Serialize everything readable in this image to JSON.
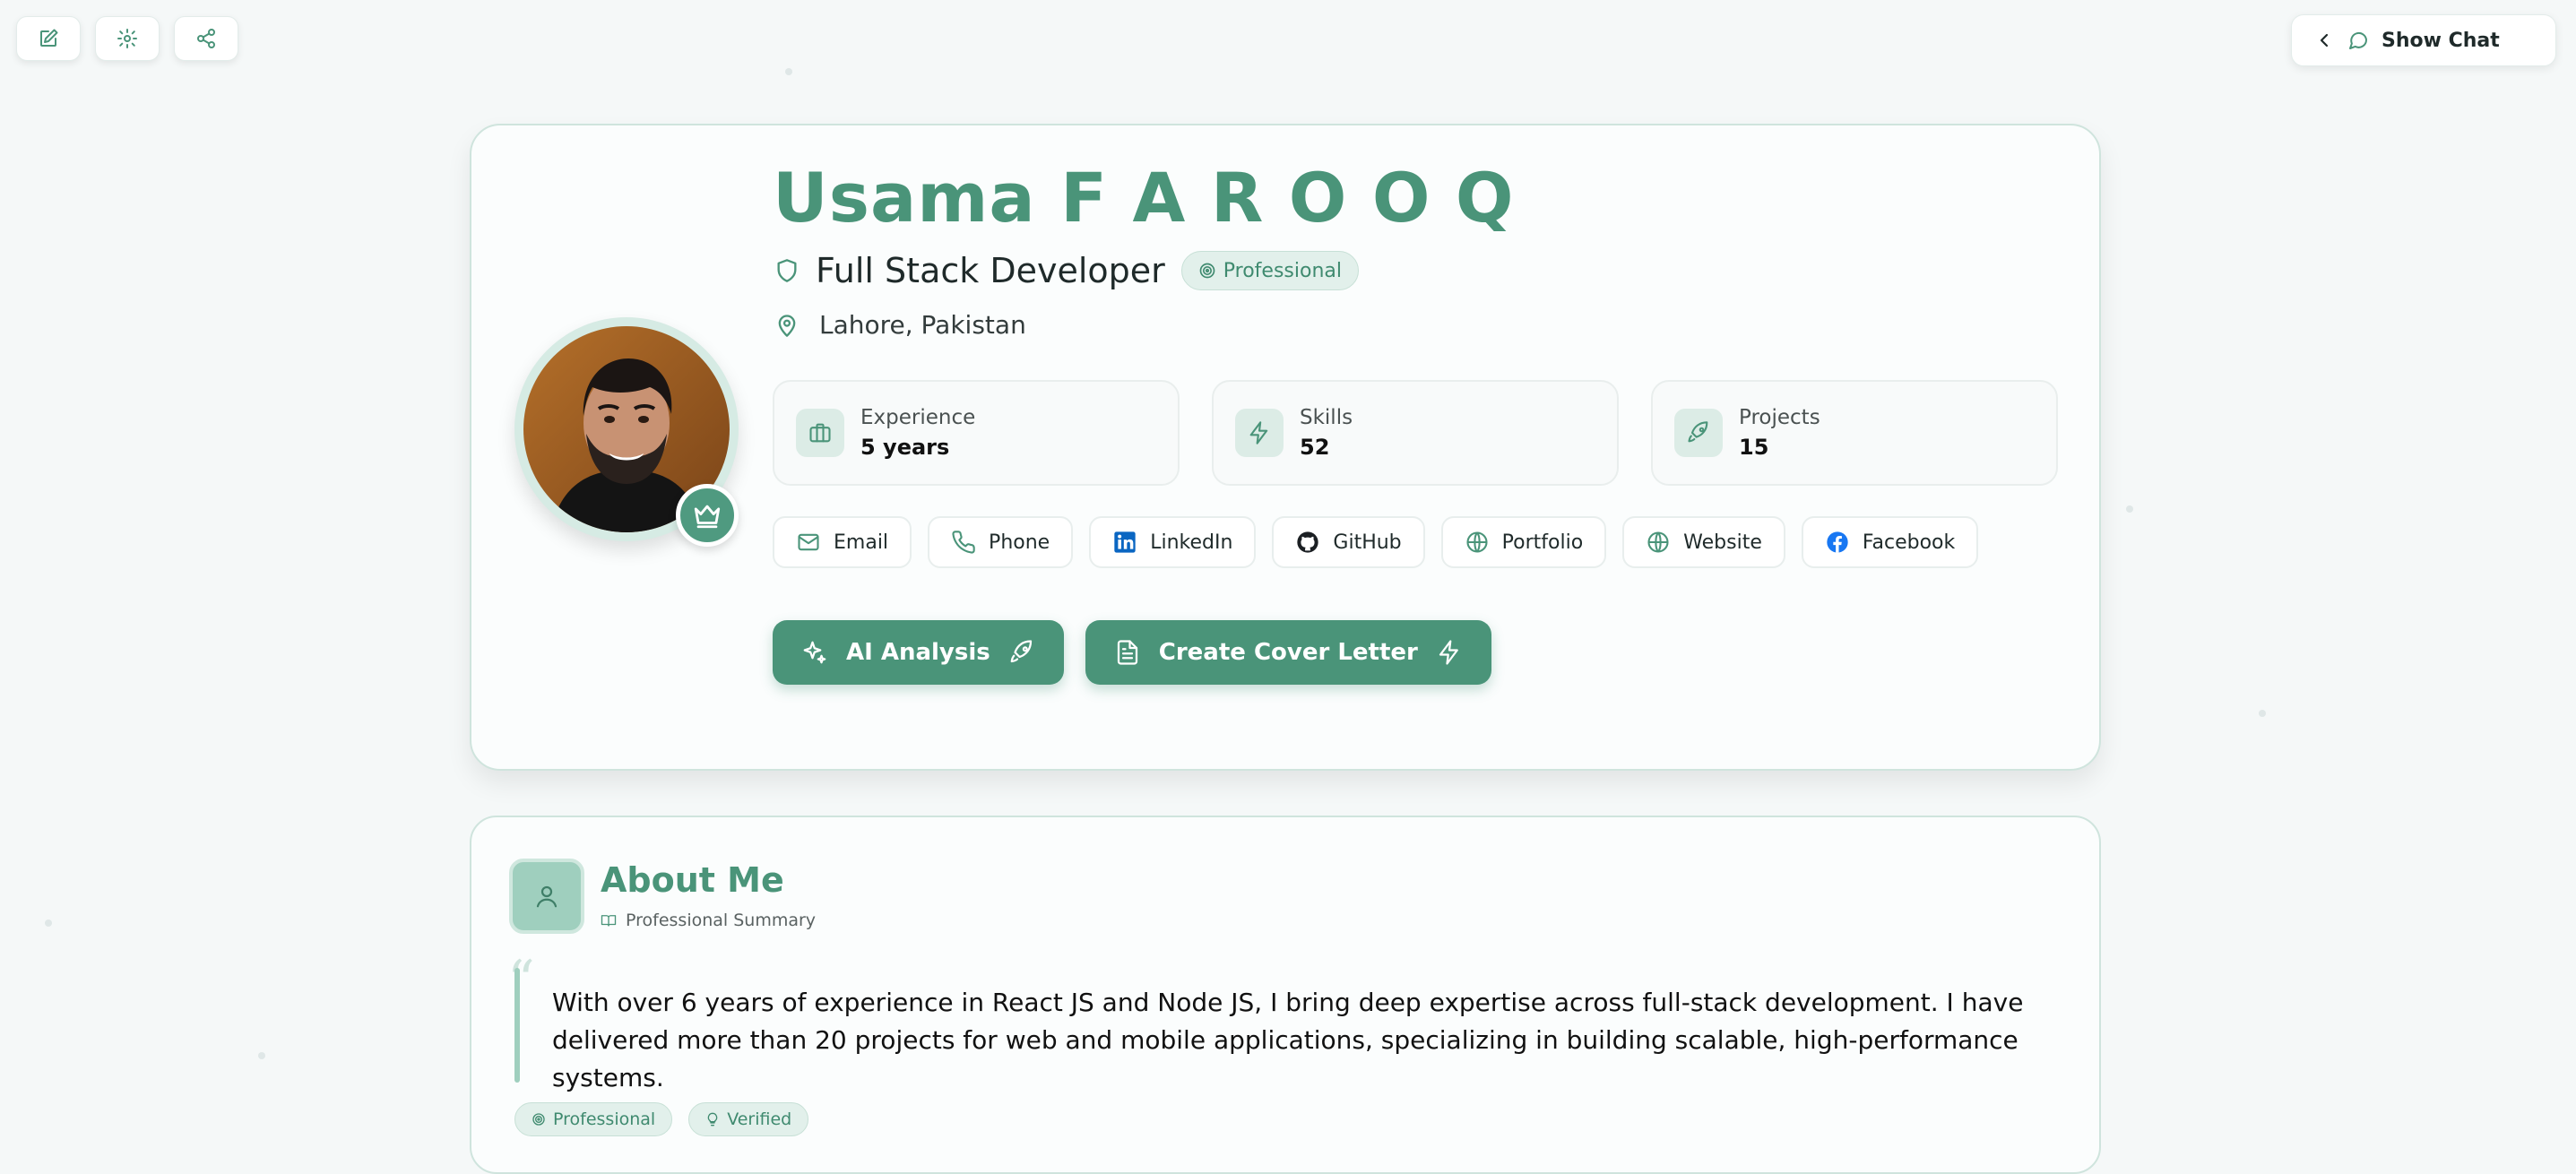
{
  "toolbar": {
    "edit_icon": "edit-icon",
    "settings_icon": "gear-icon",
    "share_icon": "share-icon"
  },
  "chat": {
    "label": "Show Chat"
  },
  "profile": {
    "name": "Usama F A R O O Q",
    "role": "Full Stack Developer",
    "badge": "Professional",
    "location": "Lahore, Pakistan",
    "stats": [
      {
        "label": "Experience",
        "value": "5 years"
      },
      {
        "label": "Skills",
        "value": "52"
      },
      {
        "label": "Projects",
        "value": "15"
      }
    ],
    "links": [
      {
        "label": "Email"
      },
      {
        "label": "Phone"
      },
      {
        "label": "LinkedIn"
      },
      {
        "label": "GitHub"
      },
      {
        "label": "Portfolio"
      },
      {
        "label": "Website"
      },
      {
        "label": "Facebook"
      }
    ],
    "actions": {
      "ai_analysis": "AI Analysis",
      "cover_letter": "Create Cover Letter"
    }
  },
  "about": {
    "title": "About Me",
    "subtitle": "Professional Summary",
    "summary": "With over 6 years of experience in React JS and Node JS, I bring deep expertise across full-stack development. I have delivered more than 20 projects for web and mobile applications, specializing in building scalable, high-performance systems.",
    "tags": [
      "Professional",
      "Verified"
    ]
  },
  "colors": {
    "accent": "#4a9479",
    "accent_light": "#e2f0eb",
    "background": "#f5f8f8"
  }
}
